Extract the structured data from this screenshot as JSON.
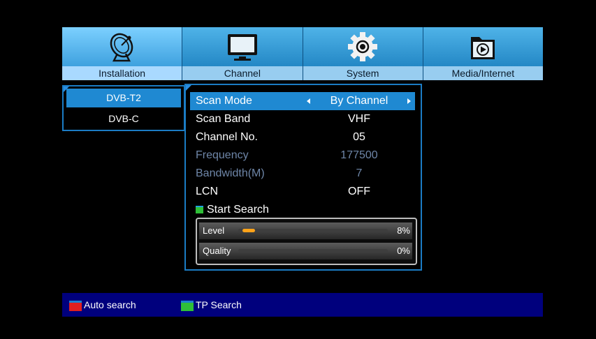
{
  "tabs": [
    {
      "label": "Installation",
      "icon": "satellite-dish-icon",
      "active": true
    },
    {
      "label": "Channel",
      "icon": "tv-icon",
      "active": false
    },
    {
      "label": "System",
      "icon": "gear-icon",
      "active": false
    },
    {
      "label": "Media/Internet",
      "icon": "media-folder-icon",
      "active": false
    }
  ],
  "left_list": {
    "items": [
      {
        "label": "DVB-T2",
        "selected": true
      },
      {
        "label": "DVB-C",
        "selected": false
      }
    ]
  },
  "panel": {
    "rows": [
      {
        "label": "Scan Mode",
        "value": "By Channel",
        "selected": true,
        "dim": false
      },
      {
        "label": "Scan Band",
        "value": "VHF",
        "selected": false,
        "dim": false
      },
      {
        "label": "Channel No.",
        "value": "05",
        "selected": false,
        "dim": false
      },
      {
        "label": "Frequency",
        "value": "177500",
        "selected": false,
        "dim": true
      },
      {
        "label": "Bandwidth(M)",
        "value": "7",
        "selected": false,
        "dim": true
      },
      {
        "label": "LCN",
        "value": "OFF",
        "selected": false,
        "dim": false
      }
    ],
    "start_search": "Start Search",
    "signal": {
      "level": {
        "label": "Level",
        "percent_text": "8%",
        "value": 8
      },
      "quality": {
        "label": "Quality",
        "percent_text": "0%",
        "value": 0
      }
    }
  },
  "bottom": {
    "auto_search": "Auto search",
    "tp_search": "TP Search"
  },
  "colors": {
    "highlight": "#1f89d2",
    "bottom_bar": "#00007d",
    "red_key": "#e02020",
    "green_key": "#2fbf38",
    "level_fill": "#ffa319"
  }
}
